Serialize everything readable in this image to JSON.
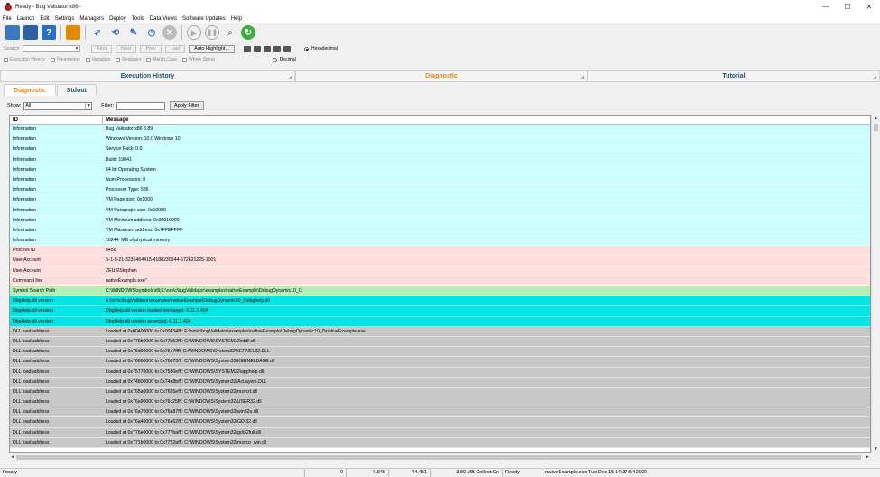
{
  "window": {
    "title": "Ready - Bug Validator x86 -"
  },
  "window_controls": [
    "—",
    "☐",
    "✕"
  ],
  "menu": [
    "File",
    "Launch",
    "Edit",
    "Settings",
    "Managers",
    "Deploy",
    "Tools",
    "Data Views",
    "Software Updates",
    "Help"
  ],
  "search": {
    "label": "Search",
    "buttons": [
      "First",
      "Next",
      "Prev",
      "Last",
      "Auto Highlight..."
    ],
    "checkboxes": [
      "Execution History",
      "Parameters",
      "Variables",
      "Registers",
      "Match Case",
      "Whole String"
    ],
    "radios": [
      "Hexadecimal",
      "Decimal"
    ]
  },
  "panes": [
    "Execution History",
    "Diagnostic",
    "Tutorial"
  ],
  "subtabs": [
    "Diagnostic",
    "Stdout"
  ],
  "filter": {
    "show_label": "Show:",
    "show_value": "All",
    "filter_label": "Filter:",
    "apply_label": "Apply Filter"
  },
  "table": {
    "columns": [
      "ID",
      "Message"
    ],
    "rows": [
      {
        "id": "Information",
        "msg": "Bug Validator x86 3.89",
        "color": "#ccffff"
      },
      {
        "id": "Information",
        "msg": "Windows Version: 10.0 Windows 10",
        "color": "#ccffff"
      },
      {
        "id": "Information",
        "msg": "Service Pack: 0.0",
        "color": "#ccffff"
      },
      {
        "id": "Information",
        "msg": "Build: 19041",
        "color": "#ccffff"
      },
      {
        "id": "Information",
        "msg": "64 bit Operating System",
        "color": "#ccffff"
      },
      {
        "id": "Information",
        "msg": "Num Processors: 8",
        "color": "#ccffff"
      },
      {
        "id": "Information",
        "msg": "Processor Type: 586",
        "color": "#ccffff"
      },
      {
        "id": "Information",
        "msg": "VM Page size: 0x1000",
        "color": "#ccffff"
      },
      {
        "id": "Information",
        "msg": "VM Paragraph size: 0x10000",
        "color": "#ccffff"
      },
      {
        "id": "Information",
        "msg": "VM Minimum address: 0x00010000",
        "color": "#ccffff"
      },
      {
        "id": "Information",
        "msg": "VM Maximum address: 0x7FFEFFFF",
        "color": "#ccffff"
      },
      {
        "id": "Information",
        "msg": "16244: MB of physical memory",
        "color": "#ccffff"
      },
      {
        "id": "Process ID",
        "msg": "6456",
        "color": "#ffdede"
      },
      {
        "id": "User Account",
        "msg": "S-1-5-21-3235464415-4188230944-672621225-1001",
        "color": "#ffdede"
      },
      {
        "id": "User Account",
        "msg": "ZEUS\\Stephen",
        "color": "#ffdede"
      },
      {
        "id": "Command line",
        "msg": "nativeExample.exe\"",
        "color": "#ffdede"
      },
      {
        "id": "Symbol Search Path",
        "msg": "C:\\WINDOWS\\symbols\\dll;E:\\om\\c\\bugValidator\\examples\\nativeExample\\DebugDynamic10_0;",
        "color": "#b4f0b4"
      },
      {
        "id": "DbgHelp.dll version",
        "msg": "E:\\om\\c\\bugValidator\\examples\\nativeExample\\DebugDynamic10_0\\dbghelp.dll",
        "color": "#00e6e6"
      },
      {
        "id": "DbgHelp.dll version",
        "msg": "DbgHelp.dll version loaded into target: 6.11.1.404",
        "color": "#00e6e6"
      },
      {
        "id": "DbgHelp.dll version",
        "msg": "DbgHelp.dll version expected: 6.11.1.404",
        "color": "#00e6e6"
      },
      {
        "id": "DLL load address",
        "msg": "Loaded at 0x00400000 to 0x00434fff: E:\\om\\c\\bugValidator\\examples\\nativeExample\\DebugDynamic10_0\\nativeExample.exe",
        "color": "#c8c8c8"
      },
      {
        "id": "DLL load address",
        "msg": "Loaded at 0x779b0000 to 0x77b52fff: C:\\WINDOWS\\SYSTEM32\\ntdll.dll",
        "color": "#c8c8c8"
      },
      {
        "id": "DLL load address",
        "msg": "Loaded at 0x75d90000 to 0x75e7ffff: C:\\WINDOWS\\System32\\KERNEL32.DLL",
        "color": "#c8c8c8"
      },
      {
        "id": "DLL load address",
        "msg": "Loaded at 0x76660000 to 0x76873fff: C:\\WINDOWS\\System32\\KERNELBASE.dll",
        "color": "#c8c8c8"
      },
      {
        "id": "DLL load address",
        "msg": "Loaded at 0x75770000 to 0x7580efff: C:\\WINDOWS\\SYSTEM32\\apphelp.dll",
        "color": "#c8c8c8"
      },
      {
        "id": "DLL load address",
        "msg": "Loaded at 0x74800000 to 0x74a8bfff: C:\\WINDOWS\\System32\\AcLayers.DLL",
        "color": "#c8c8c8"
      },
      {
        "id": "DLL load address",
        "msg": "Loaded at 0x765a0000 to 0x7665efff: C:\\WINDOWS\\System32\\msvcrt.dll",
        "color": "#c8c8c8"
      },
      {
        "id": "DLL load address",
        "msg": "Loaded at 0x76a90000 to 0x76c25fff: C:\\WINDOWS\\System32\\USER32.dll",
        "color": "#c8c8c8"
      },
      {
        "id": "DLL load address",
        "msg": "Loaded at 0x76a70000 to 0x76a87fff: C:\\WINDOWS\\System32\\win32u.dll",
        "color": "#c8c8c8"
      },
      {
        "id": "DLL load address",
        "msg": "Loaded at 0x76a40000 to 0x76a62fff: C:\\WINDOWS\\System32\\GDI32.dll",
        "color": "#c8c8c8"
      },
      {
        "id": "DLL load address",
        "msg": "Loaded at 0x776e0000 to 0x777bafff: C:\\WINDOWS\\System32\\gdi32full.dll",
        "color": "#c8c8c8"
      },
      {
        "id": "DLL load address",
        "msg": "Loaded at 0x771b0000 to 0x7722afff: C:\\WINDOWS\\System32\\msvcp_win.dll",
        "color": "#c8c8c8"
      }
    ]
  },
  "status": {
    "ready": "Ready",
    "count0": "0",
    "count1": "9,845",
    "count2": "44,451",
    "mem": "3.80 MB Collect:On",
    "state": "Ready",
    "target": "nativeExample.exe:Tue Dec 15 14:37:54 2020"
  }
}
